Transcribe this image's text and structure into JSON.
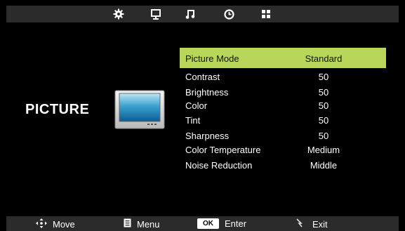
{
  "top_tabs": [
    {
      "icon": "gear-icon"
    },
    {
      "icon": "monitor-icon"
    },
    {
      "icon": "music-note-icon"
    },
    {
      "icon": "clock-icon"
    },
    {
      "icon": "grid-icon"
    }
  ],
  "section": {
    "title": "PICTURE",
    "icon": "tv-icon"
  },
  "menu": {
    "items": [
      {
        "label": "Picture Mode",
        "value": "Standard",
        "selected": true
      },
      {
        "label": "Contrast",
        "value": "50"
      },
      {
        "label": "Brightness",
        "value": "50"
      },
      {
        "label": "Color",
        "value": "50"
      },
      {
        "label": "Tint",
        "value": "50"
      },
      {
        "label": "Sharpness",
        "value": "50"
      },
      {
        "label": "Color Temperature",
        "value": "Medium"
      },
      {
        "label": "Noise Reduction",
        "value": "Middle"
      }
    ]
  },
  "footer": {
    "move_label": "Move",
    "menu_label": "Menu",
    "ok_key": "OK",
    "enter_label": "Enter",
    "exit_label": "Exit"
  },
  "colors": {
    "highlight": "#b7d65a",
    "bar_background": "#2b2b2b",
    "background": "#000000"
  }
}
